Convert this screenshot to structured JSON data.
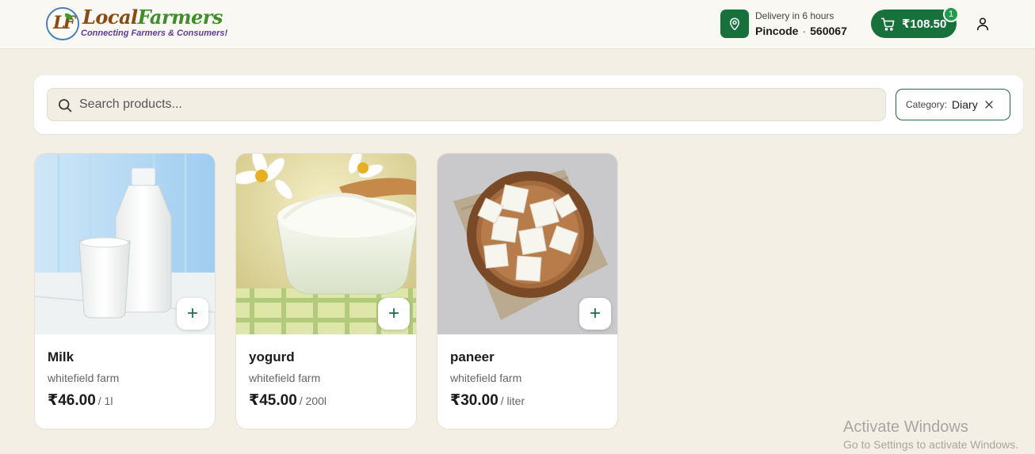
{
  "header": {
    "logo": {
      "mark_letters": "LF",
      "title_part1": "Local",
      "title_part2": "Farmers",
      "subtitle": "Connecting Farmers & Consumers!"
    },
    "location_icon": "map-pin-icon",
    "delivery_text": "Delivery in 6 hours",
    "pincode_label": "Pincode",
    "pincode_sep": "·",
    "pincode_value": "560067",
    "cart": {
      "icon": "shopping-cart-icon",
      "amount": "₹108.50",
      "badge_count": "1"
    },
    "user_icon": "user-icon",
    "accent_color": "#17713a"
  },
  "search": {
    "icon": "search-icon",
    "placeholder": "Search products...",
    "value": "",
    "filter_chip": {
      "label": "Category:",
      "value": "Diary",
      "close_icon": "close-icon"
    }
  },
  "products": [
    {
      "name": "Milk",
      "farm": "whitefield farm",
      "price": "₹46.00",
      "unit": "/ 1l",
      "add_label": "+"
    },
    {
      "name": "yogurd",
      "farm": "whitefield farm",
      "price": "₹45.00",
      "unit": "/ 200l",
      "add_label": "+"
    },
    {
      "name": "paneer",
      "farm": "whitefield farm",
      "price": "₹30.00",
      "unit": "/ liter",
      "add_label": "+"
    }
  ],
  "watermark": {
    "line1": "Activate Windows",
    "line2": "Go to Settings to activate Windows."
  }
}
